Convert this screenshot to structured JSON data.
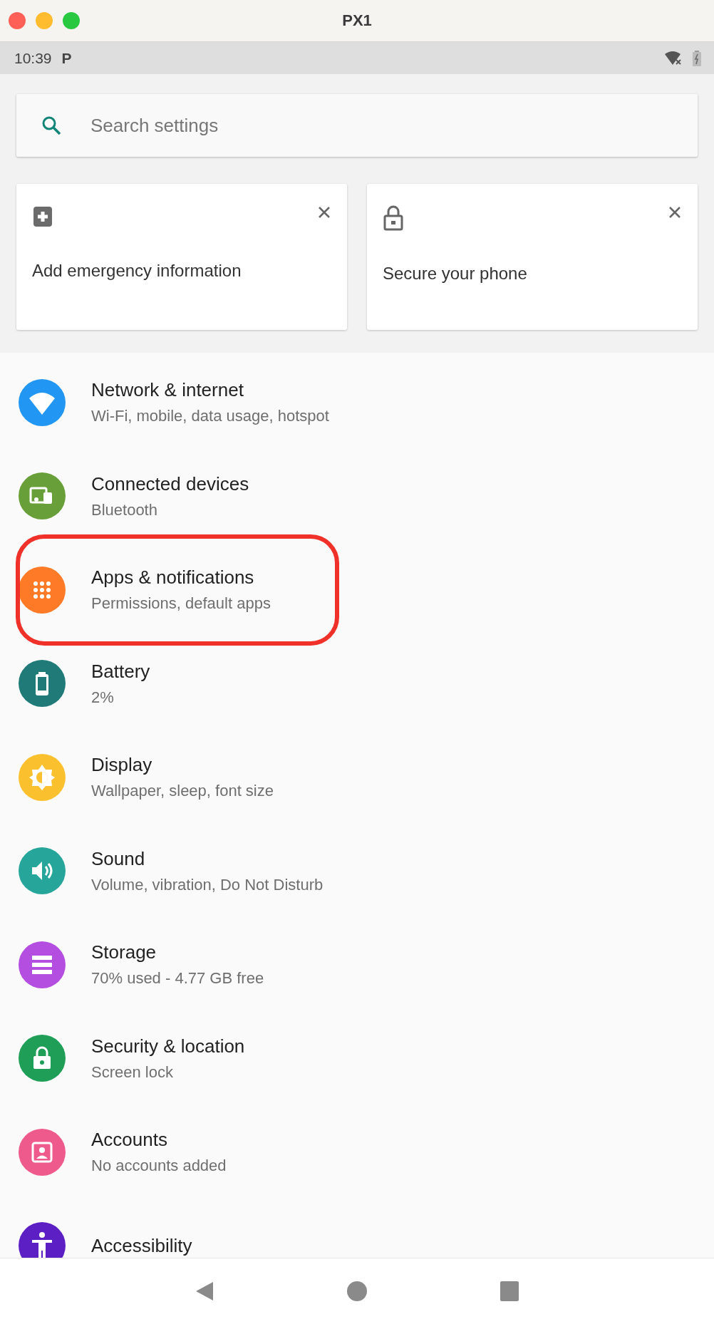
{
  "window": {
    "title": "PX1"
  },
  "status_bar": {
    "time": "10:39",
    "notification": "P"
  },
  "search": {
    "placeholder": "Search settings"
  },
  "suggestions": [
    {
      "title": "Add emergency information"
    },
    {
      "title": "Secure your phone"
    }
  ],
  "settings": [
    {
      "title": "Network & internet",
      "subtitle": "Wi-Fi, mobile, data usage, hotspot",
      "color": "#2196f3",
      "highlighted": false
    },
    {
      "title": "Connected devices",
      "subtitle": "Bluetooth",
      "color": "#689f38",
      "highlighted": false
    },
    {
      "title": "Apps & notifications",
      "subtitle": "Permissions, default apps",
      "color": "#ff7a26",
      "highlighted": true
    },
    {
      "title": "Battery",
      "subtitle": "2%",
      "color": "#1f7a78",
      "highlighted": false
    },
    {
      "title": "Display",
      "subtitle": "Wallpaper, sleep, font size",
      "color": "#fbc02d",
      "highlighted": false
    },
    {
      "title": "Sound",
      "subtitle": "Volume, vibration, Do Not Disturb",
      "color": "#26a69a",
      "highlighted": false
    },
    {
      "title": "Storage",
      "subtitle": "70% used - 4.77 GB free",
      "color": "#b44ee0",
      "highlighted": false
    },
    {
      "title": "Security & location",
      "subtitle": "Screen lock",
      "color": "#1e9e57",
      "highlighted": false
    },
    {
      "title": "Accounts",
      "subtitle": "No accounts added",
      "color": "#ef5a8c",
      "highlighted": false
    },
    {
      "title": "Accessibility",
      "color": "#5c1fc4",
      "highlighted": false
    }
  ]
}
